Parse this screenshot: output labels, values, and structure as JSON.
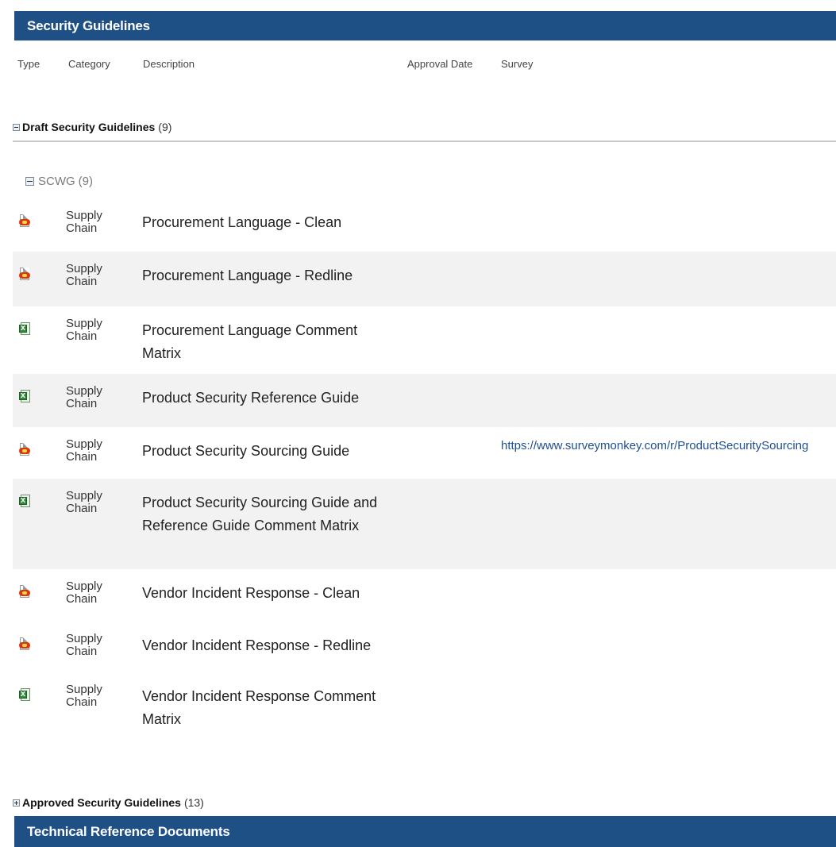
{
  "sections": {
    "security_title": "Security Guidelines",
    "technical_title": "Technical Reference Documents"
  },
  "columns": {
    "type": "Type",
    "category": "Category",
    "description": "Description",
    "approval_date": "Approval Date",
    "survey": "Survey"
  },
  "groups": {
    "draft": {
      "label": "Draft Security Guidelines",
      "count": "(9)",
      "expanded": true
    },
    "scwg": {
      "label": "SCWG",
      "count": "(9)",
      "expanded": true
    },
    "approved": {
      "label": "Approved Security Guidelines",
      "count": "(13)",
      "expanded": false
    }
  },
  "rows": [
    {
      "type_icon": "pdf-icon",
      "category_line1": "Supply",
      "category_line2": "Chain",
      "description": "Procurement Language - Clean",
      "survey": ""
    },
    {
      "type_icon": "pdf-icon",
      "category_line1": "Supply",
      "category_line2": "Chain",
      "description": "Procurement Language - Redline",
      "survey": ""
    },
    {
      "type_icon": "excel-icon",
      "category_line1": "Supply",
      "category_line2": "Chain",
      "description": "Procurement Language Comment Matrix",
      "survey": ""
    },
    {
      "type_icon": "excel-icon",
      "category_line1": "Supply",
      "category_line2": "Chain",
      "description": "Product Security Reference Guide",
      "survey": ""
    },
    {
      "type_icon": "pdf-icon",
      "category_line1": "Supply",
      "category_line2": "Chain",
      "description": "Product Security Sourcing Guide",
      "survey": "https://www.surveymonkey.com/r/ProductSecuritySourcing"
    },
    {
      "type_icon": "excel-icon",
      "category_line1": "Supply",
      "category_line2": "Chain",
      "description": "Product Security Sourcing Guide and Reference Guide Comment Matrix",
      "survey": ""
    },
    {
      "type_icon": "pdf-icon",
      "category_line1": "Supply",
      "category_line2": "Chain",
      "description": "Vendor Incident Response - Clean",
      "survey": ""
    },
    {
      "type_icon": "pdf-icon",
      "category_line1": "Supply",
      "category_line2": "Chain",
      "description": "Vendor Incident Response - Redline",
      "survey": ""
    },
    {
      "type_icon": "excel-icon",
      "category_line1": "Supply",
      "category_line2": "Chain",
      "description": "Vendor Incident Response Comment Matrix",
      "survey": ""
    }
  ],
  "colors": {
    "header_bg": "#1e4f85",
    "link": "#1f4f8c",
    "alt_row": "#f2f2f2"
  }
}
